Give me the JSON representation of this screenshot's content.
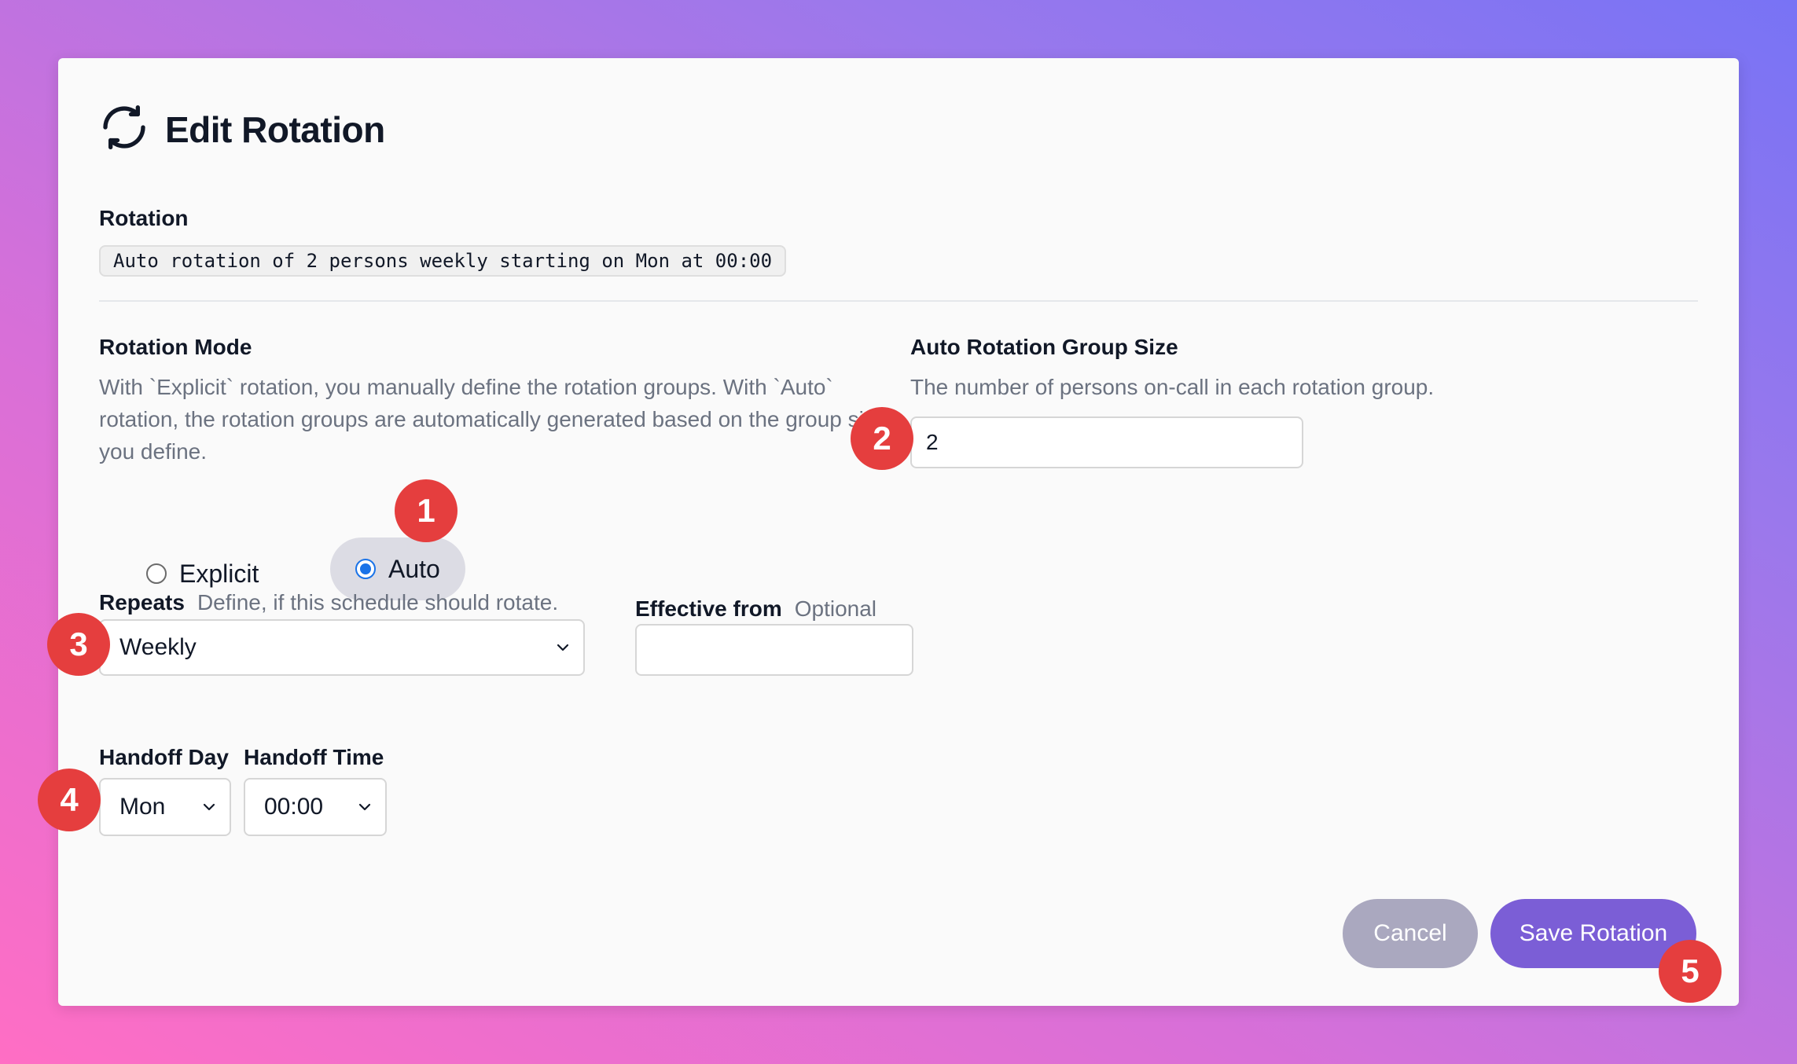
{
  "dialog": {
    "title": "Edit Rotation",
    "title_icon": "refresh-icon"
  },
  "rotation": {
    "label": "Rotation",
    "summary": "Auto rotation of 2 persons weekly starting on Mon at 00:00"
  },
  "mode": {
    "label": "Rotation Mode",
    "help": "With `Explicit` rotation, you manually define the rotation groups. With `Auto` rotation, the rotation groups are automatically generated based on the group size you define.",
    "options": [
      "Explicit",
      "Auto"
    ],
    "selected": "Auto"
  },
  "group_size": {
    "label": "Auto Rotation Group Size",
    "help": "The number of persons on-call in each rotation group.",
    "value": "2"
  },
  "repeats": {
    "label": "Repeats",
    "help": "Define, if this schedule should rotate.",
    "value": "Weekly"
  },
  "effective_from": {
    "label": "Effective from",
    "hint": "Optional",
    "value": ""
  },
  "handoff": {
    "day_label": "Handoff Day",
    "day_value": "Mon",
    "time_label": "Handoff Time",
    "time_value": "00:00"
  },
  "actions": {
    "cancel": "Cancel",
    "save": "Save Rotation"
  },
  "badges": [
    "1",
    "2",
    "3",
    "4",
    "5"
  ],
  "colors": {
    "accent": "#7b5ed6",
    "cancel": "#aaa8bf",
    "badge": "#e53e3e",
    "radio": "#1a73e8"
  }
}
